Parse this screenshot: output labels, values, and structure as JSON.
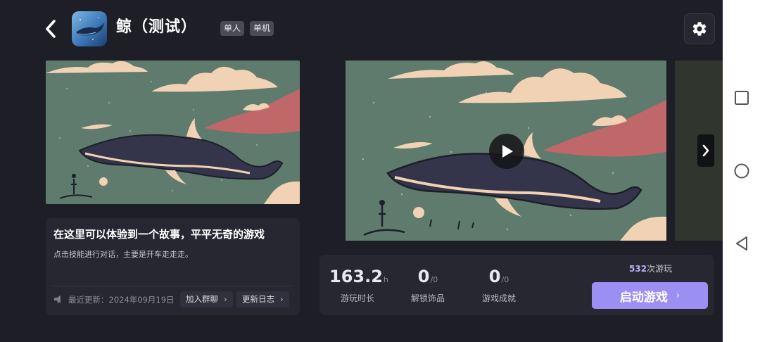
{
  "header": {
    "title": "鲸（测试）",
    "tags": [
      "单人",
      "单机"
    ]
  },
  "icons": {
    "back": "chevron-left-icon",
    "settings": "gear-icon",
    "play": "play-icon",
    "next": "chevron-right-icon",
    "update": "megaphone-icon",
    "nav_square": "square-icon",
    "nav_circle": "circle-icon",
    "nav_back": "triangle-back-icon"
  },
  "description": {
    "title": "在这里可以体验到一个故事，平平无奇的游戏",
    "subtitle": "点击技能进行对话，主要是开车走走走。",
    "update_text": "最近更新：2024年09月19日",
    "join_group_label": "加入群聊",
    "changelog_label": "更新日志"
  },
  "stats": {
    "play_time_value": "163.2",
    "play_time_unit": "h",
    "play_time_label": "游玩时长",
    "decorations_value": "0",
    "decorations_unit": "/0",
    "decorations_label": "解锁饰品",
    "achievements_value": "0",
    "achievements_unit": "/0",
    "achievements_label": "游戏成就"
  },
  "launch": {
    "play_count": "532",
    "play_count_suffix": "次游玩",
    "button_label": "启动游戏"
  },
  "colors": {
    "background": "#1d1e26",
    "card": "#262731",
    "accent": "#9c8ff4",
    "sky": "#5e7b6e",
    "cloud": "#f1d2b4",
    "whale": "#34354a"
  }
}
